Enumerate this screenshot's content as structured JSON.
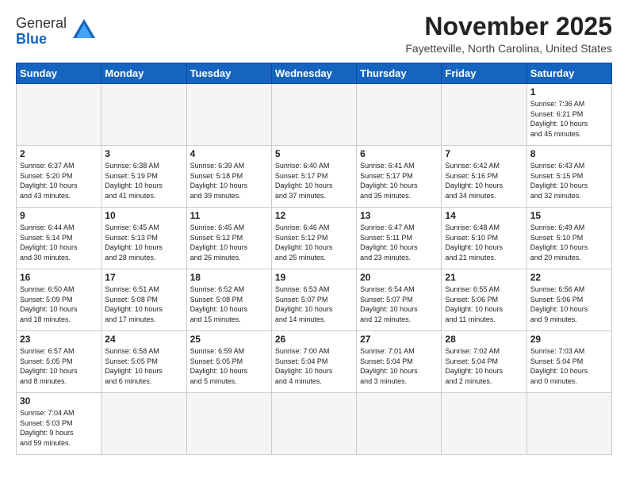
{
  "logo": {
    "general": "General",
    "blue": "Blue"
  },
  "header": {
    "month": "November 2025",
    "location": "Fayetteville, North Carolina, United States"
  },
  "weekdays": [
    "Sunday",
    "Monday",
    "Tuesday",
    "Wednesday",
    "Thursday",
    "Friday",
    "Saturday"
  ],
  "weeks": [
    [
      {
        "day": "",
        "empty": true
      },
      {
        "day": "",
        "empty": true
      },
      {
        "day": "",
        "empty": true
      },
      {
        "day": "",
        "empty": true
      },
      {
        "day": "",
        "empty": true
      },
      {
        "day": "",
        "empty": true
      },
      {
        "day": "1",
        "info": "Sunrise: 7:36 AM\nSunset: 6:21 PM\nDaylight: 10 hours\nand 45 minutes."
      }
    ],
    [
      {
        "day": "2",
        "info": "Sunrise: 6:37 AM\nSunset: 5:20 PM\nDaylight: 10 hours\nand 43 minutes."
      },
      {
        "day": "3",
        "info": "Sunrise: 6:38 AM\nSunset: 5:19 PM\nDaylight: 10 hours\nand 41 minutes."
      },
      {
        "day": "4",
        "info": "Sunrise: 6:39 AM\nSunset: 5:18 PM\nDaylight: 10 hours\nand 39 minutes."
      },
      {
        "day": "5",
        "info": "Sunrise: 6:40 AM\nSunset: 5:17 PM\nDaylight: 10 hours\nand 37 minutes."
      },
      {
        "day": "6",
        "info": "Sunrise: 6:41 AM\nSunset: 5:17 PM\nDaylight: 10 hours\nand 35 minutes."
      },
      {
        "day": "7",
        "info": "Sunrise: 6:42 AM\nSunset: 5:16 PM\nDaylight: 10 hours\nand 34 minutes."
      },
      {
        "day": "8",
        "info": "Sunrise: 6:43 AM\nSunset: 5:15 PM\nDaylight: 10 hours\nand 32 minutes."
      }
    ],
    [
      {
        "day": "9",
        "info": "Sunrise: 6:44 AM\nSunset: 5:14 PM\nDaylight: 10 hours\nand 30 minutes."
      },
      {
        "day": "10",
        "info": "Sunrise: 6:45 AM\nSunset: 5:13 PM\nDaylight: 10 hours\nand 28 minutes."
      },
      {
        "day": "11",
        "info": "Sunrise: 6:45 AM\nSunset: 5:12 PM\nDaylight: 10 hours\nand 26 minutes."
      },
      {
        "day": "12",
        "info": "Sunrise: 6:46 AM\nSunset: 5:12 PM\nDaylight: 10 hours\nand 25 minutes."
      },
      {
        "day": "13",
        "info": "Sunrise: 6:47 AM\nSunset: 5:11 PM\nDaylight: 10 hours\nand 23 minutes."
      },
      {
        "day": "14",
        "info": "Sunrise: 6:48 AM\nSunset: 5:10 PM\nDaylight: 10 hours\nand 21 minutes."
      },
      {
        "day": "15",
        "info": "Sunrise: 6:49 AM\nSunset: 5:10 PM\nDaylight: 10 hours\nand 20 minutes."
      }
    ],
    [
      {
        "day": "16",
        "info": "Sunrise: 6:50 AM\nSunset: 5:09 PM\nDaylight: 10 hours\nand 18 minutes."
      },
      {
        "day": "17",
        "info": "Sunrise: 6:51 AM\nSunset: 5:08 PM\nDaylight: 10 hours\nand 17 minutes."
      },
      {
        "day": "18",
        "info": "Sunrise: 6:52 AM\nSunset: 5:08 PM\nDaylight: 10 hours\nand 15 minutes."
      },
      {
        "day": "19",
        "info": "Sunrise: 6:53 AM\nSunset: 5:07 PM\nDaylight: 10 hours\nand 14 minutes."
      },
      {
        "day": "20",
        "info": "Sunrise: 6:54 AM\nSunset: 5:07 PM\nDaylight: 10 hours\nand 12 minutes."
      },
      {
        "day": "21",
        "info": "Sunrise: 6:55 AM\nSunset: 5:06 PM\nDaylight: 10 hours\nand 11 minutes."
      },
      {
        "day": "22",
        "info": "Sunrise: 6:56 AM\nSunset: 5:06 PM\nDaylight: 10 hours\nand 9 minutes."
      }
    ],
    [
      {
        "day": "23",
        "info": "Sunrise: 6:57 AM\nSunset: 5:05 PM\nDaylight: 10 hours\nand 8 minutes."
      },
      {
        "day": "24",
        "info": "Sunrise: 6:58 AM\nSunset: 5:05 PM\nDaylight: 10 hours\nand 6 minutes."
      },
      {
        "day": "25",
        "info": "Sunrise: 6:59 AM\nSunset: 5:05 PM\nDaylight: 10 hours\nand 5 minutes."
      },
      {
        "day": "26",
        "info": "Sunrise: 7:00 AM\nSunset: 5:04 PM\nDaylight: 10 hours\nand 4 minutes."
      },
      {
        "day": "27",
        "info": "Sunrise: 7:01 AM\nSunset: 5:04 PM\nDaylight: 10 hours\nand 3 minutes."
      },
      {
        "day": "28",
        "info": "Sunrise: 7:02 AM\nSunset: 5:04 PM\nDaylight: 10 hours\nand 2 minutes."
      },
      {
        "day": "29",
        "info": "Sunrise: 7:03 AM\nSunset: 5:04 PM\nDaylight: 10 hours\nand 0 minutes."
      }
    ],
    [
      {
        "day": "30",
        "info": "Sunrise: 7:04 AM\nSunset: 5:03 PM\nDaylight: 9 hours\nand 59 minutes."
      },
      {
        "day": "",
        "empty": true
      },
      {
        "day": "",
        "empty": true
      },
      {
        "day": "",
        "empty": true
      },
      {
        "day": "",
        "empty": true
      },
      {
        "day": "",
        "empty": true
      },
      {
        "day": "",
        "empty": true
      }
    ]
  ]
}
